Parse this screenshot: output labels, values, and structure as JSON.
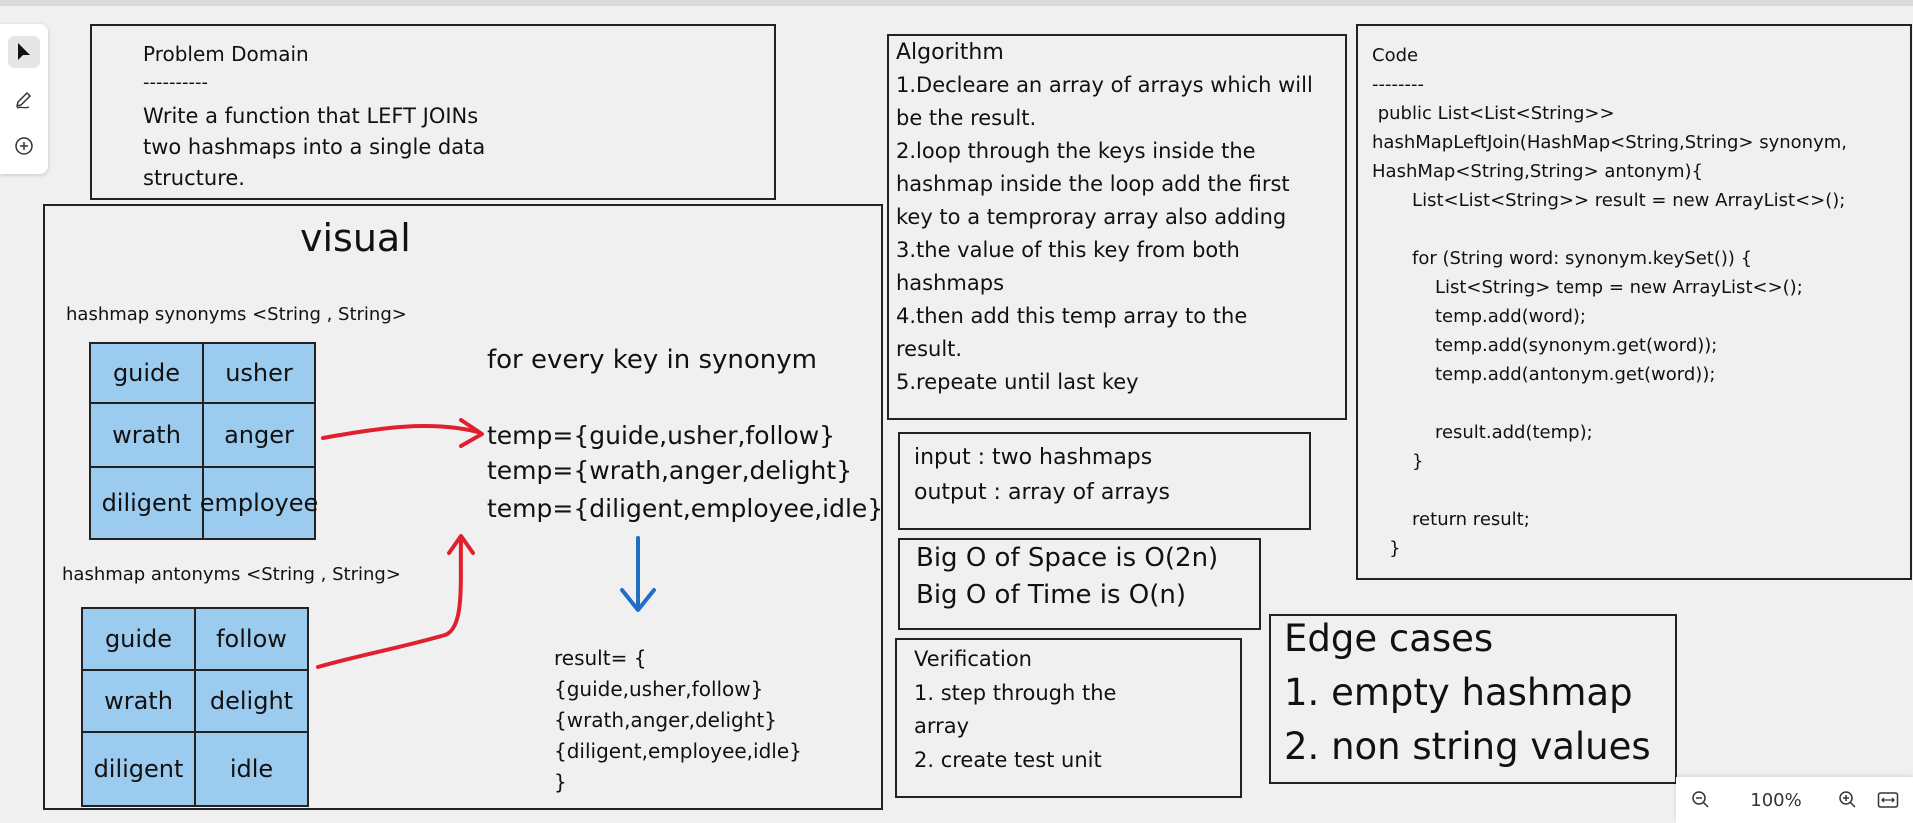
{
  "problem": {
    "title": "Problem Domain",
    "divider": "----------",
    "lines": [
      "Write a function that LEFT JOINs",
      "two hashmaps into a single data",
      "structure."
    ]
  },
  "visual": {
    "title": "visual",
    "synonyms_label": "hashmap synonyms <String , String>",
    "antonyms_label": "hashmap antonyms <String , String>",
    "synonyms": [
      [
        "guide",
        "usher"
      ],
      [
        "wrath",
        "anger"
      ],
      [
        "diligent",
        "employee"
      ]
    ],
    "antonyms": [
      [
        "guide",
        "follow"
      ],
      [
        "wrath",
        "delight"
      ],
      [
        "diligent",
        "idle"
      ]
    ],
    "for_every": "for every key in synonym",
    "temps": [
      "temp={guide,usher,follow}",
      "temp={wrath,anger,delight}",
      "temp={diligent,employee,idle}"
    ],
    "result_lines": [
      "result= {",
      "{guide,usher,follow}",
      "{wrath,anger,delight}",
      "{diligent,employee,idle}",
      "}"
    ],
    "arrow_red": "#e0202e",
    "arrow_blue": "#1f6fc4",
    "cell_fill": "#9ccbf0"
  },
  "algorithm": {
    "lines": [
      "Algorithm",
      "1.Decleare an array of arrays which will",
      "be the result.",
      "2.loop through the keys inside the",
      "hashmap inside the loop add the first",
      "key to a temproray array also adding",
      "3.the value of this key from both",
      "hashmaps",
      "4.then add this temp array to the",
      "result.",
      "5.repeate until last key"
    ]
  },
  "io": {
    "lines": [
      "input : two hashmaps",
      "output : array of arrays"
    ]
  },
  "bigo": {
    "lines": [
      "Big O of Space is O(2n)",
      "Big O of Time is O(n)"
    ]
  },
  "verification": {
    "lines": [
      "Verification",
      "1. step through the",
      "array",
      "2. create test unit"
    ]
  },
  "edge": {
    "lines": [
      "Edge cases",
      "1. empty hashmap",
      "2. non string values"
    ]
  },
  "code": {
    "lines": [
      "Code",
      "--------",
      " public List<List<String>>",
      "hashMapLeftJoin(HashMap<String,String> synonym,",
      "HashMap<String,String> antonym){",
      "       List<List<String>> result = new ArrayList<>();",
      "",
      "       for (String word: synonym.keySet()) {",
      "           List<String> temp = new ArrayList<>();",
      "           temp.add(word);",
      "           temp.add(synonym.get(word));",
      "           temp.add(antonym.get(word));",
      "",
      "           result.add(temp);",
      "       }",
      "",
      "       return result;",
      "   }"
    ]
  },
  "zoom": {
    "level": "100%"
  },
  "icons": {
    "select": "pointer-icon",
    "pen": "pen-icon",
    "add": "plus-circle-icon",
    "zoom_out": "zoom-out-icon",
    "zoom_in": "zoom-in-icon",
    "fit": "fit-width-icon"
  }
}
